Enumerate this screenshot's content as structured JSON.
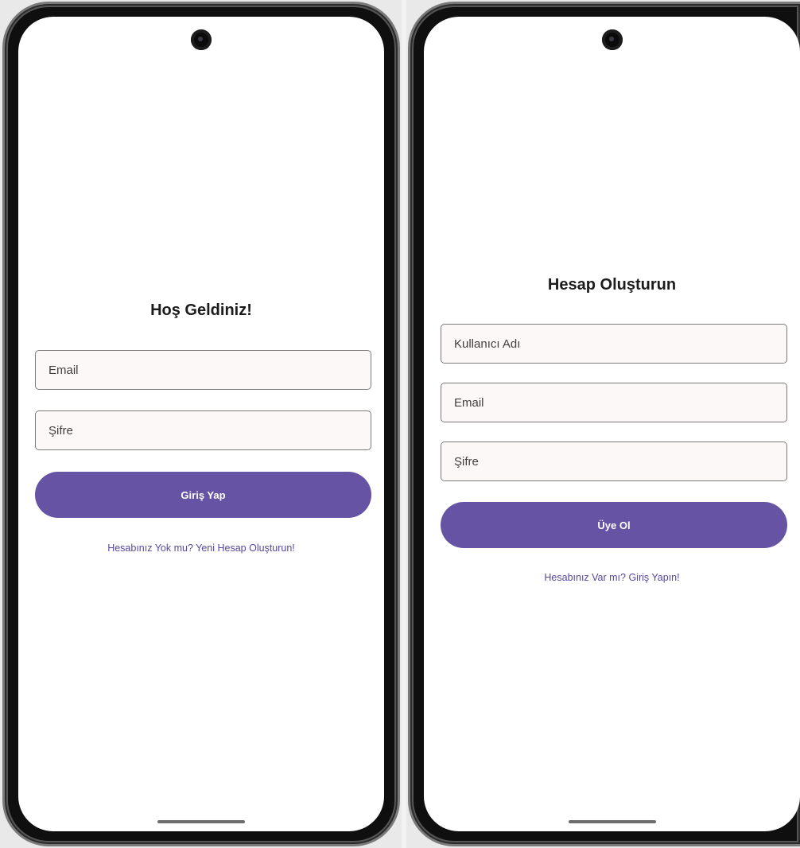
{
  "login_screen": {
    "title": "Hoş Geldiniz!",
    "email_placeholder": "Email",
    "password_placeholder": "Şifre",
    "submit_label": "Giriş Yap",
    "signup_link": "Hesabınız Yok mu? Yeni Hesap Oluşturun!"
  },
  "register_screen": {
    "title": "Hesap Oluşturun",
    "username_placeholder": "Kullanıcı Adı",
    "email_placeholder": "Email",
    "password_placeholder": "Şifre",
    "submit_label": "Üye Ol",
    "login_link": "Hesabınız Var mı? Giriş Yapın!"
  },
  "colors": {
    "primary": "#6653a4",
    "link": "#5a46a0",
    "field_background": "#fdf8f8",
    "field_border": "#7b7b7b"
  },
  "icons": [
    "front-camera-icon",
    "home-indicator-icon"
  ]
}
